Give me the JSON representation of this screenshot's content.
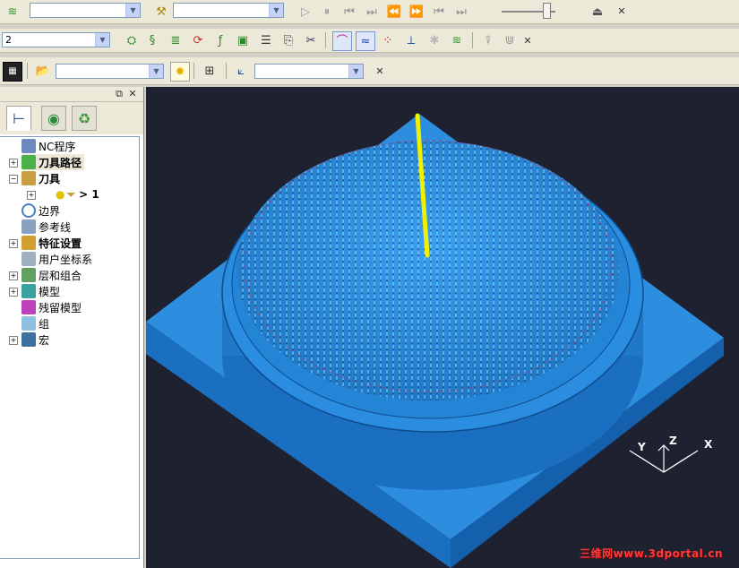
{
  "toolbar1": {
    "combo1_value": "",
    "combo2_value": ""
  },
  "toolbar2": {
    "tool_combo_value": "2"
  },
  "toolbar3": {
    "combo1_value": "",
    "combo2_value": ""
  },
  "tree": {
    "items": [
      {
        "label": "NC程序",
        "bold": false
      },
      {
        "label": "刀具路径",
        "bold": true
      },
      {
        "label": "刀具",
        "bold": true
      },
      {
        "label": "> 1",
        "bold": true
      },
      {
        "label": "边界",
        "bold": false
      },
      {
        "label": "参考线",
        "bold": false
      },
      {
        "label": "特征设置",
        "bold": true
      },
      {
        "label": "用户坐标系",
        "bold": false
      },
      {
        "label": "层和组合",
        "bold": false
      },
      {
        "label": "模型",
        "bold": false
      },
      {
        "label": "残留模型",
        "bold": false
      },
      {
        "label": "组",
        "bold": false
      },
      {
        "label": "宏",
        "bold": false
      }
    ]
  },
  "viewport": {
    "axis_y": "Y",
    "axis_z": "Z",
    "axis_x": "X",
    "watermark": "三维网www.3dportal.cn",
    "colors": {
      "background": "#1e2230",
      "model": "#2f8fe0",
      "toolpath": "#6ad0f0",
      "tool": "#f0f000"
    }
  }
}
